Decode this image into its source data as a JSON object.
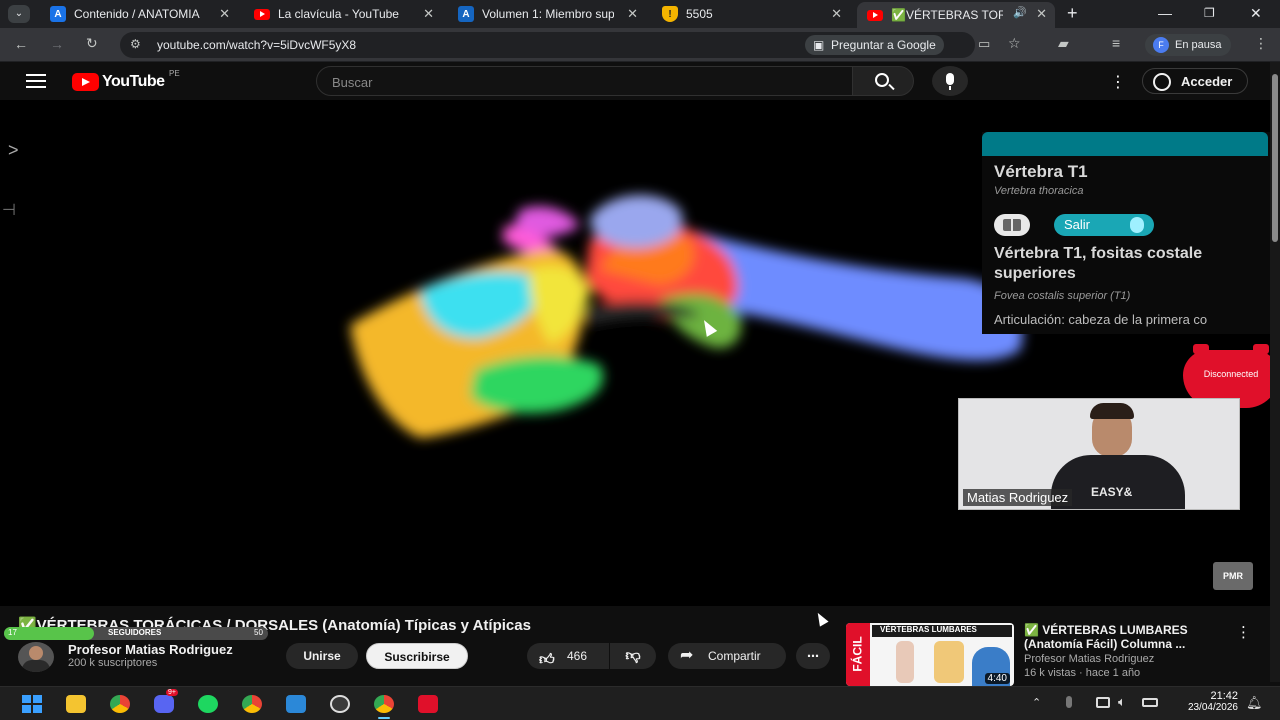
{
  "browser": {
    "tabs": [
      {
        "title": "Contenido / ANATOMIA",
        "icon": "a-letter-icon",
        "color": "#1a73e8"
      },
      {
        "title": "La clavícula - YouTube",
        "icon": "youtube-icon",
        "color": "#ff0000"
      },
      {
        "title": "Volumen 1: Miembro sup",
        "icon": "a-letter-icon",
        "color": "#1a73e8"
      },
      {
        "title": "5505",
        "icon": "shield-icon",
        "color": "#f4b400"
      },
      {
        "title": "✅VÉRTEBRAS TORÁ",
        "icon": "youtube-icon",
        "color": "#ff0000",
        "active": true
      }
    ],
    "url": "youtube.com/watch?v=5iDvcWF5yX8",
    "ask_google": "Preguntar a Google",
    "profile": {
      "initial": "F",
      "label": "En pausa"
    }
  },
  "youtube": {
    "logo": "YouTube",
    "country": "PE",
    "search_placeholder": "Buscar",
    "signin": "Acceder"
  },
  "video": {
    "panel": {
      "title": "Vértebra T1",
      "subtitle": "Vertebra thoracica",
      "exit": "Salir",
      "heading": "Vértebra T1, fositas costale superiores",
      "latin": "Fovea costalis superior (T1)",
      "articulation": "Articulación: cabeza de la primera co"
    },
    "webcam_name": "Matias Rodriguez",
    "webcam_shirt": "EASY&",
    "disconnected": "Disconnected",
    "watermark": "PMR"
  },
  "below": {
    "title": "✅VÉRTEBRAS TORÁCICAS / DORSALES (Anatomía) Típicas y Atípicas",
    "followers_label": "SEGUIDORES",
    "followers_left": "17",
    "followers_right": "50",
    "channel": "Profesor Matias Rodriguez",
    "subscribers": "200 k suscriptores",
    "join": "Unirse",
    "subscribe": "Suscribirse",
    "likes": "466",
    "share": "Compartir",
    "recommended": {
      "thumb_text": "VÉRTEBRAS LUMBARES",
      "thumb_side": "FÁCIL",
      "duration": "4:40",
      "title": "✅ VÉRTEBRAS LUMBARES (Anatomía Fácil) Columna ...",
      "channel": "Profesor Matias Rodriguez",
      "meta": "16 k vistas · hace 1 año"
    }
  },
  "taskbar": {
    "time": "21:42",
    "date": "23/04/2026",
    "discord_badge": "9+"
  }
}
